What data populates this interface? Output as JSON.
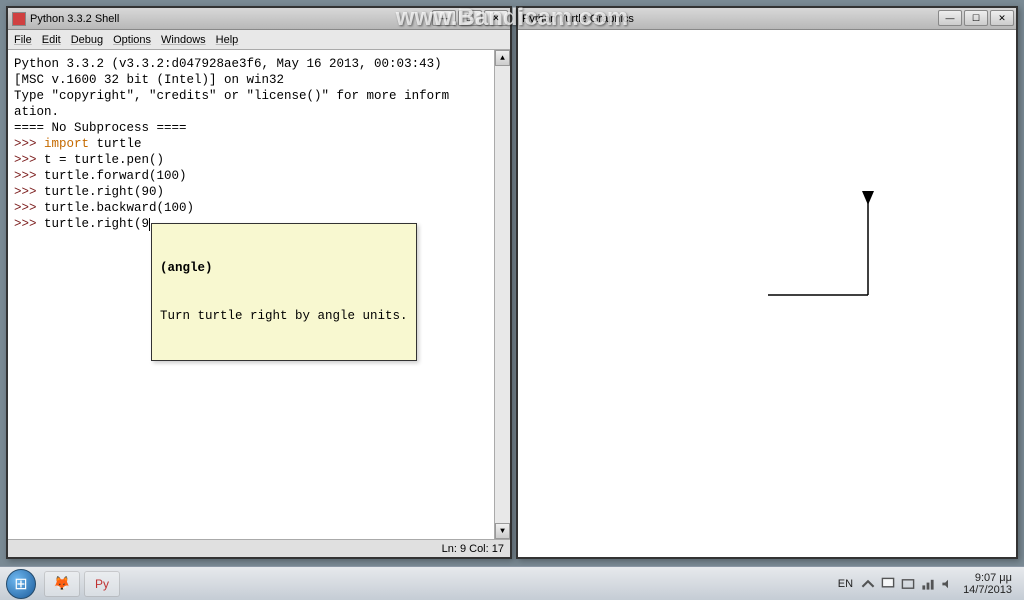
{
  "watermark": "www.Bandicam.com",
  "shell": {
    "title": "Python 3.3.2 Shell",
    "menus": [
      "File",
      "Edit",
      "Debug",
      "Options",
      "Windows",
      "Help"
    ],
    "banner_lines": [
      "Python 3.3.2 (v3.3.2:d047928ae3f6, May 16 2013, 00:03:43)",
      "[MSC v.1600 32 bit (Intel)] on win32",
      "Type \"copyright\", \"credits\" or \"license()\" for more inform",
      "ation.",
      "==== No Subprocess ===="
    ],
    "prompt": ">>>",
    "lines": [
      {
        "keyword": "import",
        "rest": " turtle"
      },
      {
        "code": "t = turtle.pen()"
      },
      {
        "code": "turtle.forward(100)"
      },
      {
        "code": "turtle.right(90)"
      },
      {
        "code": "turtle.backward(100)"
      },
      {
        "code": "turtle.right(9"
      }
    ],
    "tooltip": {
      "signature": "(angle)",
      "doc": "Turn turtle right by angle units."
    },
    "status": {
      "ln_label": "Ln:",
      "ln": "9",
      "col_label": "Col:",
      "col": "17"
    }
  },
  "turtle_window": {
    "title": "Python Turtle Graphics"
  },
  "taskbar": {
    "lang": "EN",
    "time": "9:07 μμ",
    "date": "14/7/2013"
  }
}
